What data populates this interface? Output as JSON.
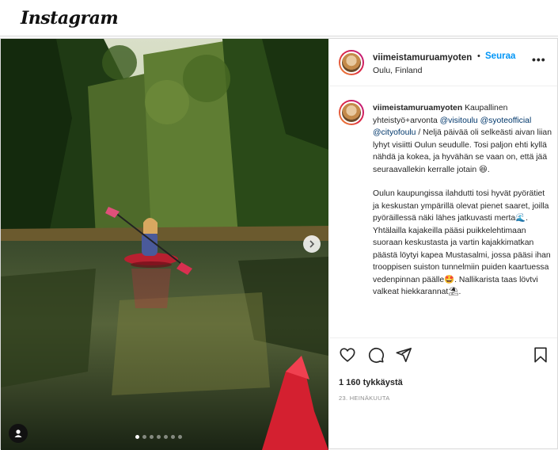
{
  "app": {
    "logo": "Instagram"
  },
  "post": {
    "username": "viimeistamuruamyoten",
    "separator": "•",
    "follow_label": "Seuraa",
    "location": "Oulu, Finland",
    "more_label": "•••",
    "caption": {
      "username": "viimeistamuruamyoten",
      "p1_a": " Kaupallinen yhteistyö+arvonta ",
      "mention1": "@visitoulu",
      "mention2": "@syoteofficial",
      "mention3": "@cityofoulu",
      "p1_b": " / Neljä päivää oli selkeästi aivan liian lyhyt visiitti Oulun seudulle. Tosi paljon ehti kyllä nähdä ja kokea, ja hyvähän se vaan on, että jää seuraavallekin kerralle jotain 😆.",
      "p2": "Oulun kaupungissa ilahdutti tosi hyvät pyörätiet ja keskustan ympärillä olevat pienet saaret, joilla pyöräillessä näki lähes jatkuvasti merta🌊.",
      "p3": "Yhtälailla kajakeilla pääsi puikkelehtimaan suoraan keskustasta ja vartin kajakkimatkan päästä löytyi kapea Mustasalmi, jossa pääsi ihan trooppisen suiston tunnelmiin puiden kaartuessa vedenpinnan päälle🤩. Nallikarista taas lövtvi valkeat hiekkarannat⛱."
    },
    "likes": "1 160 tykkäystä",
    "date": "23. HEINÄKUUTA",
    "carousel": {
      "count": 7,
      "active": 0
    },
    "icons": [
      "heart-icon",
      "comment-icon",
      "share-icon",
      "bookmark-icon",
      "chevron-right-icon",
      "user-tag-icon"
    ]
  }
}
